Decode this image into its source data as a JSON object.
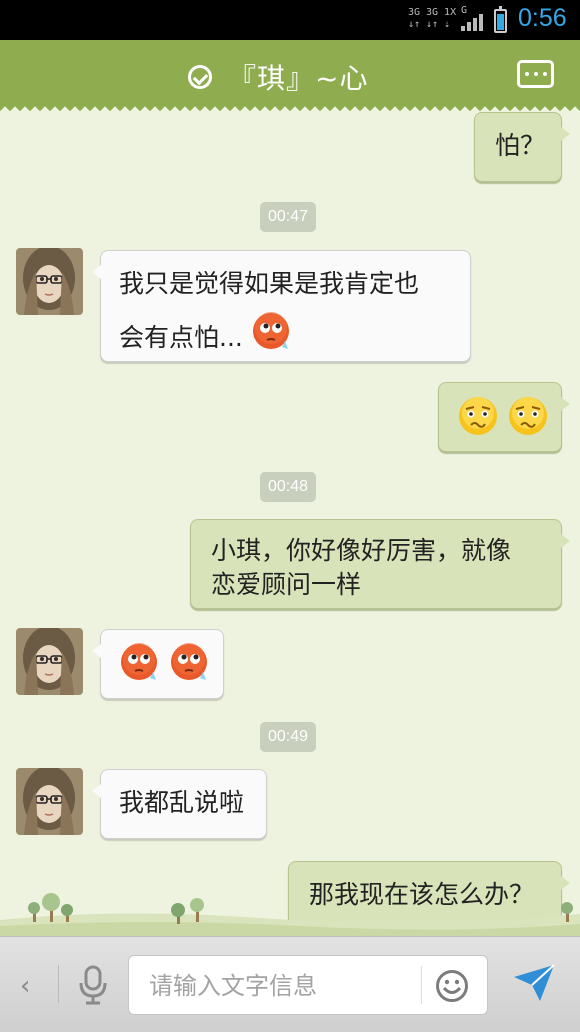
{
  "status_bar": {
    "net1_top": "3G",
    "net1_bottom": "↓↑",
    "net2_top": "3G 1X",
    "net2_bottom": "↓↑ ⇣",
    "net3": "G",
    "time": "0:56"
  },
  "header": {
    "title": "『琪』~心"
  },
  "messages": [
    {
      "side": "right",
      "text": "怕？"
    },
    {
      "type": "time",
      "text": "00:47"
    },
    {
      "side": "left",
      "line1": "我只是觉得如果是我肯定也",
      "line2": "会有点怕..."
    },
    {
      "side": "right",
      "emoji": [
        "worried-face",
        "worried-face"
      ]
    },
    {
      "type": "time",
      "text": "00:48"
    },
    {
      "side": "right",
      "line1": "小琪，你好像好厉害，就像",
      "line2": "恋爱顾问一样"
    },
    {
      "side": "left",
      "emoji": [
        "sweat-face",
        "sweat-face"
      ]
    },
    {
      "type": "time",
      "text": "00:49"
    },
    {
      "side": "left",
      "text": "我都乱说啦"
    },
    {
      "side": "right",
      "text": "那我现在该怎么办？"
    }
  ],
  "input_bar": {
    "back_label": "‹",
    "placeholder": "请输入文字信息"
  },
  "colors": {
    "title_bar": "#8fad4f",
    "background": "#eef3df",
    "right_bubble": "#d8e3b9",
    "left_bubble": "#fafafa",
    "clock": "#35a8e6",
    "send": "#2f8ed6"
  }
}
